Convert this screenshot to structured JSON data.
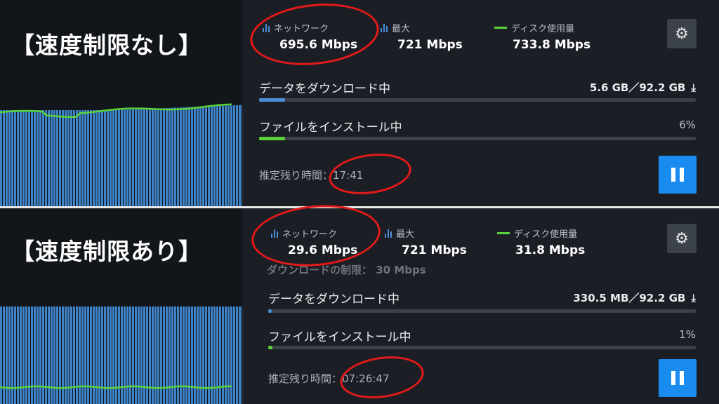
{
  "panels": {
    "top": {
      "caption": "【速度制限なし】",
      "network": {
        "label": "ネットワーク",
        "value": "695.6 Mbps"
      },
      "peak": {
        "label": "最大",
        "value": "721 Mbps"
      },
      "disk": {
        "label": "ディスク使用量",
        "value": "733.8 Mbps"
      },
      "download": {
        "label": "データをダウンロード中",
        "size": "5.6 GB／92.2 GB",
        "progress": 0.06
      },
      "install": {
        "label": "ファイルをインストール中",
        "percent": "6%",
        "progress": 0.06
      },
      "eta": {
        "label": "推定残り時間：",
        "value": "17:41"
      }
    },
    "bottom": {
      "caption": "【速度制限あり】",
      "network": {
        "label": "ネットワーク",
        "value": "29.6 Mbps"
      },
      "peak": {
        "label": "最大",
        "value": "721 Mbps"
      },
      "disk": {
        "label": "ディスク使用量",
        "value": "31.8 Mbps"
      },
      "limit_text": "ダウンロードの制限： 30 Mbps",
      "download": {
        "label": "データをダウンロード中",
        "size": "330.5 MB／92.2 GB",
        "progress": 0.004
      },
      "install": {
        "label": "ファイルをインストール中",
        "percent": "1%",
        "progress": 0.01
      },
      "eta": {
        "label": "推定残り時間：",
        "value": "07:26:47"
      }
    }
  },
  "icons": {
    "settings": "gear-icon",
    "pause": "pause-icon",
    "download": "download-icon",
    "network": "bar-chart-icon",
    "disk": "line-legend-icon"
  },
  "colors": {
    "accent": "#1a8cf0",
    "network_bar": "#4a8ed8",
    "disk_line": "#5ad33a",
    "annotation": "#e21a1a"
  }
}
